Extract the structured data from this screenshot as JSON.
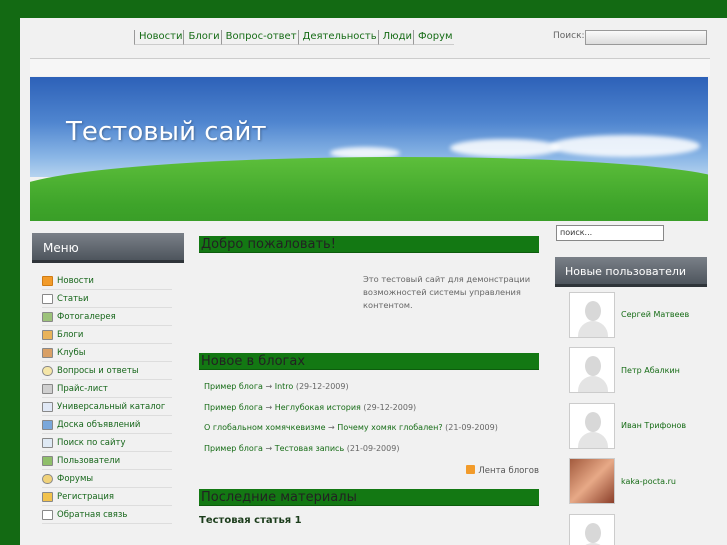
{
  "top_nav": [
    "Новости",
    "Блоги",
    "Вопрос-ответ",
    "Деятельность",
    "Люди",
    "Форум"
  ],
  "top_search": {
    "label": "Поиск:",
    "value": ""
  },
  "site_title": "Тестовый сайт",
  "left_menu": {
    "heading": "Меню",
    "items": [
      {
        "label": "Новости",
        "icon": "rss-icon"
      },
      {
        "label": "Статьи",
        "icon": "document-icon"
      },
      {
        "label": "Фотогалерея",
        "icon": "photo-icon"
      },
      {
        "label": "Блоги",
        "icon": "book-icon"
      },
      {
        "label": "Клубы",
        "icon": "house-icon"
      },
      {
        "label": "Вопросы и ответы",
        "icon": "speech-bubble-icon"
      },
      {
        "label": "Прайс-лист",
        "icon": "cart-icon"
      },
      {
        "label": "Универсальный каталог",
        "icon": "catalog-icon"
      },
      {
        "label": "Доска объявлений",
        "icon": "board-icon"
      },
      {
        "label": "Поиск по сайту",
        "icon": "search-icon"
      },
      {
        "label": "Пользователи",
        "icon": "users-icon"
      },
      {
        "label": "Форумы",
        "icon": "forum-icon"
      },
      {
        "label": "Регистрация",
        "icon": "tag-icon"
      },
      {
        "label": "Обратная связь",
        "icon": "feedback-icon"
      }
    ]
  },
  "welcome": {
    "heading": "Добро пожаловать!",
    "text": "Это тестовый сайт для демонстрации возможностей системы управления контентом."
  },
  "blogs": {
    "heading": "Новое в блогах",
    "items": [
      {
        "blog": "Пример блога",
        "post": "Intro",
        "date": "(29-12-2009)"
      },
      {
        "blog": "Пример блога",
        "post": "Неглубокая история",
        "date": "(29-12-2009)"
      },
      {
        "blog": "О глобальном хомячкевизме",
        "post": "Почему хомяк глобален?",
        "date": "(21-09-2009)"
      },
      {
        "blog": "Пример блога",
        "post": "Тестовая запись",
        "date": "(21-09-2009)"
      }
    ],
    "feed_label": "Лента блогов",
    "arrow": "→"
  },
  "latest": {
    "heading": "Последние материалы",
    "first_title": "Тестовая статья 1"
  },
  "right_search": {
    "value": "поиск..."
  },
  "new_users": {
    "heading": "Новые пользователи",
    "users": [
      {
        "name": "Сергей Матвеев",
        "photo": false
      },
      {
        "name": "Петр Абалкин",
        "photo": false
      },
      {
        "name": "Иван Трифонов",
        "photo": false
      },
      {
        "name": "kaka-pocta.ru",
        "photo": true
      },
      {
        "name": "",
        "photo": false
      }
    ]
  }
}
